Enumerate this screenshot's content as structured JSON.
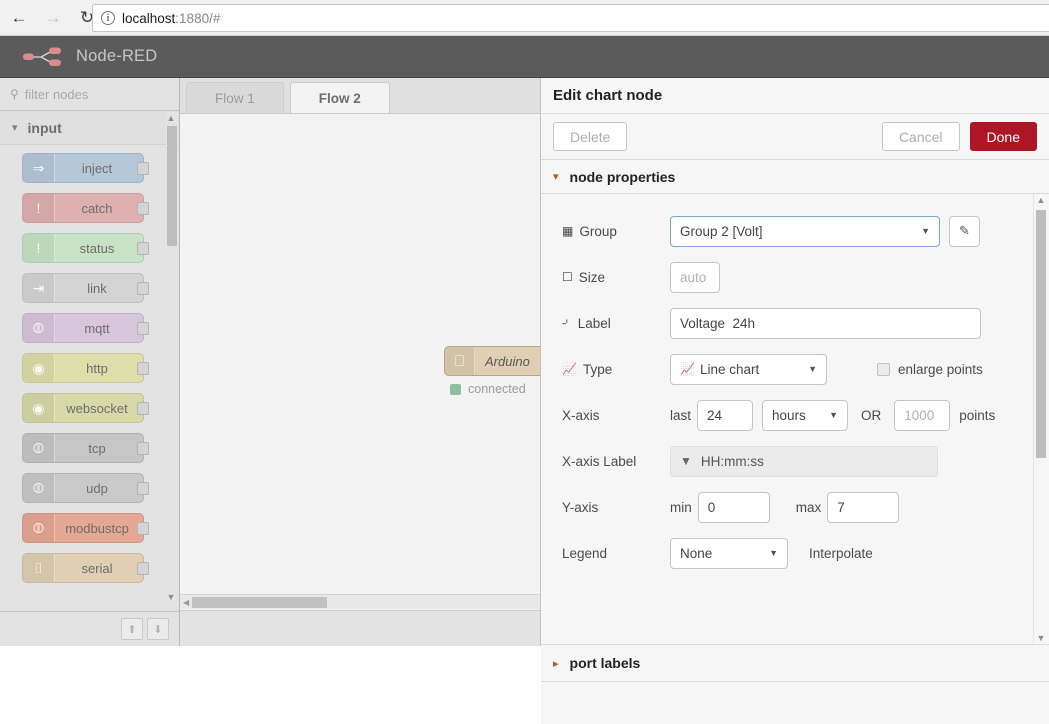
{
  "browser": {
    "back_icon": "arrow-left-icon",
    "forward_icon": "arrow-right-icon",
    "reload_icon": "reload-icon",
    "info_icon": "info-icon",
    "url_host": "localhost",
    "url_rest": ":1880/#"
  },
  "header": {
    "logo_icon": "node-red-logo-icon",
    "title": "Node-RED",
    "bg": "#5b5b5b",
    "title_color": "#c7c7c7"
  },
  "palette": {
    "search_icon": "search-icon",
    "filter_placeholder": "filter nodes",
    "category": "input",
    "category_chevron": "chevron-down-icon",
    "nodes": [
      {
        "label": "inject",
        "icon": "inject-arrow-icon",
        "color": "#b5c8d8"
      },
      {
        "label": "catch",
        "icon": "exclamation-icon",
        "color": "#dfb0b0"
      },
      {
        "label": "status",
        "icon": "exclamation-icon",
        "color": "#c7e2c4"
      },
      {
        "label": "link",
        "icon": "link-arrow-icon",
        "color": "#d4d4d4"
      },
      {
        "label": "mqtt",
        "icon": "signal-wave-icon",
        "color": "#d8c6dd"
      },
      {
        "label": "http",
        "icon": "globe-icon",
        "color": "#dedeab"
      },
      {
        "label": "websocket",
        "icon": "globe-icon",
        "color": "#d8d9a8"
      },
      {
        "label": "tcp",
        "icon": "signal-wave-icon",
        "color": "#c6c6c6"
      },
      {
        "label": "udp",
        "icon": "signal-wave-icon",
        "color": "#c9c9c9"
      },
      {
        "label": "modbustcp",
        "icon": "signal-wave-icon",
        "color": "#e5a894"
      },
      {
        "label": "serial",
        "icon": "serial-pulse-icon",
        "color": "#e0cfb3"
      }
    ],
    "collapse_all_icon": "collapse-all-icon",
    "expand_all_icon": "expand-all-icon",
    "scroll_up_icon": "scroll-up-icon",
    "scroll_down_icon": "scroll-down-icon"
  },
  "workspace": {
    "tabs": [
      {
        "label": "Flow 1",
        "active": false
      },
      {
        "label": "Flow 2",
        "active": true
      }
    ],
    "node": {
      "label": "Arduino",
      "icon": "serial-pulse-icon",
      "status_text": "connected",
      "status_color": "#8fbf9f"
    },
    "hscroll_left_icon": "scroll-left-icon"
  },
  "dialog": {
    "title": "Edit chart node",
    "buttons": {
      "delete": "Delete",
      "cancel": "Cancel",
      "done": "Done",
      "done_color": "#ad1625"
    },
    "section": {
      "label": "node properties",
      "chevron": "chevron-down-icon"
    },
    "fields": {
      "group": {
        "label": "Group",
        "icon": "table-grid-icon",
        "value": "Group 2 [Volt]",
        "caret_icon": "caret-down-icon",
        "edit_icon": "pencil-icon"
      },
      "size": {
        "label": "Size",
        "icon": "object-group-icon",
        "placeholder": "auto"
      },
      "label": {
        "label": "Label",
        "icon": "text-cursor-icon",
        "value": "Voltage  24h"
      },
      "type": {
        "label": "Type",
        "icon": "line-chart-icon",
        "value": "Line chart",
        "value_icon": "line-chart-icon",
        "caret_icon": "caret-down-icon",
        "enlarge_points_label": "enlarge points",
        "enlarge_points_checked": false
      },
      "xaxis": {
        "label": "X-axis",
        "last_prefix": "last",
        "last_value": "24",
        "unit_value": "hours",
        "unit_caret_icon": "caret-down-icon",
        "or_text": "OR",
        "points_placeholder": "1000",
        "points_suffix": "points"
      },
      "xaxis_label": {
        "label": "X-axis Label",
        "caret_icon": "caret-down-icon",
        "value": "HH:mm:ss",
        "disabled": true
      },
      "yaxis": {
        "label": "Y-axis",
        "min_prefix": "min",
        "min_value": "0",
        "max_prefix": "max",
        "max_value": "7"
      },
      "legend": {
        "label": "Legend",
        "value": "None",
        "caret_icon": "caret-down-icon",
        "interpolate_label": "Interpolate"
      }
    },
    "port_labels": {
      "label": "port labels",
      "chevron": "chevron-right-icon"
    },
    "scroll_up_icon": "scroll-up-icon",
    "scroll_down_icon": "scroll-down-icon"
  }
}
